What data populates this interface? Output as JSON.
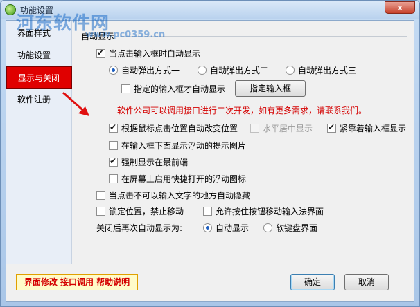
{
  "window": {
    "title": "功能设置",
    "watermark": "河东软件网",
    "watermark_sub": "www.pc0359.cn",
    "close_label": "x"
  },
  "sidebar": {
    "items": [
      {
        "label": "界面样式",
        "active": false
      },
      {
        "label": "功能设置",
        "active": false
      },
      {
        "label": "显示与关闭",
        "active": true
      },
      {
        "label": "软件注册",
        "active": false
      }
    ]
  },
  "main": {
    "group_label": "自动显示",
    "auto_show_on_focus": {
      "label": "当点击输入框时自动显示",
      "checked": true
    },
    "popup_modes": [
      {
        "label": "自动弹出方式一",
        "checked": true
      },
      {
        "label": "自动弹出方式二",
        "checked": false
      },
      {
        "label": "自动弹出方式三",
        "checked": false
      }
    ],
    "only_specified": {
      "label": "指定的输入框才自动显示",
      "checked": false
    },
    "specify_button": "指定输入框",
    "note": "软件公司可以调用接口进行二次开发，如有更多需求，请联系我们。",
    "mouse_position": {
      "label": "根据鼠标点击位置自动改变位置",
      "checked": true
    },
    "horizontal_center": {
      "label": "水平居中显示",
      "checked": false,
      "disabled": true
    },
    "stick_to_input": {
      "label": "紧靠着输入框显示",
      "checked": true
    },
    "show_float_tip": {
      "label": "在输入框下面显示浮动的提示图片",
      "checked": false
    },
    "force_topmost": {
      "label": "强制显示在最前端",
      "checked": true
    },
    "float_icon": {
      "label": "在屏幕上启用快捷打开的浮动图标",
      "checked": false
    },
    "auto_hide": {
      "label": "当点击不可以输入文字的地方自动隐藏",
      "checked": false
    },
    "lock_position": {
      "label": "锁定位置，禁止移动",
      "checked": false
    },
    "allow_drag": {
      "label": "允许按住按钮移动输入法界面",
      "checked": false
    },
    "reopen_label": "关闭后再次自动显示为:",
    "reopen_modes": [
      {
        "label": "自动显示",
        "checked": true
      },
      {
        "label": "软键盘界面",
        "checked": false
      }
    ]
  },
  "footer": {
    "link_text": "界面修改 接口调用 帮助说明",
    "ok_label": "确定",
    "cancel_label": "取消"
  },
  "colors": {
    "accent_red": "#e00000",
    "note_red": "#d40000",
    "arrow_red": "#e01010"
  }
}
